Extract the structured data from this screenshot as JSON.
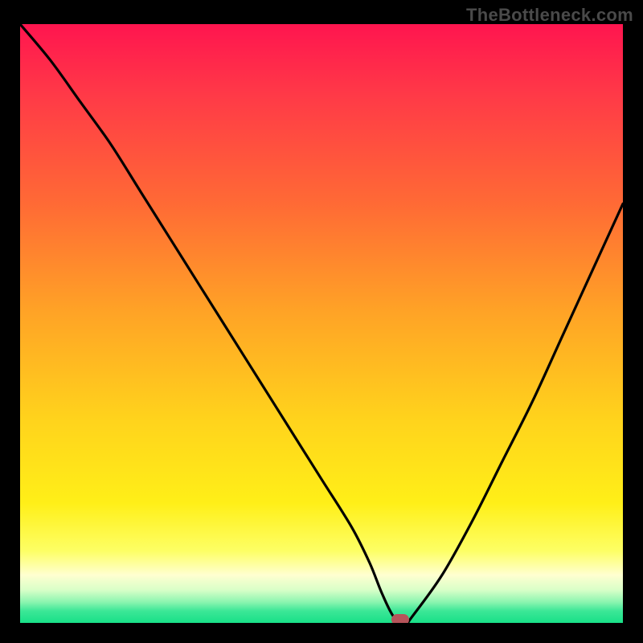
{
  "watermark": "TheBottleneck.com",
  "colors": {
    "red_top": "#ff154f",
    "red_mid": "#ff4840",
    "orange": "#ffa326",
    "yellow": "#ffe51a",
    "pale_yellow": "#ffffb0",
    "pale_green": "#b8ffc0",
    "green": "#18e088",
    "curve": "#000000",
    "frame": "#000000",
    "marker": "#b6545a"
  },
  "chart_data": {
    "type": "line",
    "title": "",
    "xlabel": "",
    "ylabel": "",
    "xlim": [
      0,
      100
    ],
    "ylim": [
      0,
      100
    ],
    "x": [
      0,
      5,
      10,
      15,
      20,
      25,
      30,
      35,
      40,
      45,
      50,
      55,
      58,
      60,
      62,
      64,
      65,
      70,
      75,
      80,
      85,
      90,
      95,
      100
    ],
    "values": [
      100,
      94,
      87,
      80,
      72,
      64,
      56,
      48,
      40,
      32,
      24,
      16,
      10,
      5,
      1,
      0,
      1,
      8,
      17,
      27,
      37,
      48,
      59,
      70
    ],
    "optimum_x": 63,
    "optimum_y": 0,
    "grid": false
  }
}
